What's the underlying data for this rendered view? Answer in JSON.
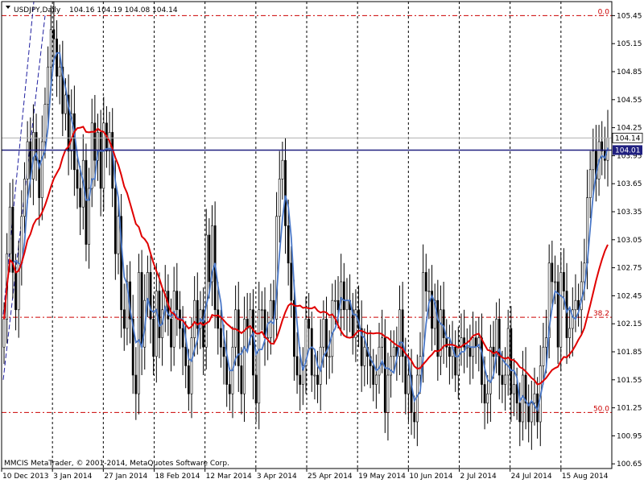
{
  "header": {
    "symbol": "USDJPY,Daily",
    "ohlc": "104.16 104.19 104.08 104.14"
  },
  "footer": {
    "copyright": "MMCIS MetaTrader, © 2001-2014, MetaQuotes Software Corp."
  },
  "colors": {
    "background": "#ffffff",
    "frame": "#000000",
    "grid": "#000000",
    "ma_fast": "#4a78c8",
    "ma_slow": "#e00000",
    "fib": "#cc0000",
    "price_line": "#202080",
    "candle_body": "#000000"
  },
  "chart_data": {
    "type": "candlestick",
    "symbol": "USDJPY",
    "timeframe": "Daily",
    "ylim": [
      100.6,
      105.6
    ],
    "grid": true,
    "y_ticks": [
      "105.45",
      "105.15",
      "104.85",
      "104.55",
      "104.25",
      "103.95",
      "103.65",
      "103.35",
      "103.05",
      "102.75",
      "102.45",
      "102.15",
      "101.85",
      "101.55",
      "101.25",
      "100.95",
      "100.65"
    ],
    "x_ticks": [
      "10 Dec 2013",
      "3 Jan 2014",
      "27 Jan 2014",
      "18 Feb 2014",
      "12 Mar 2014",
      "3 Apr 2014",
      "25 Apr 2014",
      "19 May 2014",
      "10 Jun 2014",
      "2 Jul 2014",
      "24 Jul 2014",
      "15 Aug 2014"
    ],
    "current_price_label": "104.14",
    "hline_price_label": "104.01",
    "fibonacci_levels": [
      {
        "label": "0.0",
        "price": 105.45
      },
      {
        "label": "38.2",
        "price": 102.22
      },
      {
        "label": "50.0",
        "price": 101.2
      }
    ],
    "close": [
      102.2,
      102.9,
      103.4,
      102.7,
      102.3,
      102.8,
      103.3,
      103.7,
      104.1,
      103.7,
      104.2,
      103.9,
      103.5,
      104.1,
      104.5,
      104.9,
      105.3,
      105.2,
      104.8,
      104.9,
      104.4,
      104.6,
      104.0,
      104.4,
      103.8,
      103.6,
      103.4,
      103.9,
      103.0,
      103.6,
      104.3,
      103.9,
      104.2,
      103.6,
      104.3,
      104.0,
      104.2,
      103.6,
      102.9,
      103.3,
      102.3,
      102.1,
      102.6,
      102.2,
      101.6,
      101.4,
      102.7,
      101.9,
      102.4,
      102.7,
      102.2,
      101.8,
      102.5,
      102.0,
      102.3,
      102.5,
      102.2,
      101.9,
      102.5,
      102.3,
      102.1,
      101.9,
      101.7,
      101.4,
      102.0,
      102.4,
      102.1,
      102.3,
      101.9,
      103.1,
      102.6,
      103.2,
      102.3,
      102.1,
      101.9,
      101.8,
      101.5,
      101.4,
      101.9,
      102.3,
      101.7,
      101.4,
      102.2,
      102.1,
      102.3,
      101.6,
      101.3,
      102.3,
      102.3,
      102.0,
      102.0,
      102.4,
      102.2,
      103.3,
      103.7,
      103.9,
      103.2,
      102.8,
      102.4,
      101.8,
      101.6,
      101.5,
      101.7,
      102.2,
      102.1,
      101.6,
      101.6,
      101.5,
      101.9,
      102.2,
      101.8,
      101.8,
      102.4,
      102.4,
      102.3,
      102.6,
      102.3,
      102.4,
      102.3,
      102.0,
      102.3,
      102.1,
      101.7,
      101.9,
      101.8,
      101.7,
      101.5,
      101.6,
      101.9,
      102.0,
      101.2,
      101.6,
      101.8,
      101.9,
      101.8,
      102.3,
      101.8,
      101.4,
      101.6,
      101.2,
      101.1,
      101.6,
      101.8,
      102.7,
      102.5,
      102.5,
      102.1,
      102.4,
      101.8,
      102.3,
      102.0,
      101.9,
      101.8,
      101.9,
      101.6,
      101.9,
      102.0,
      101.9,
      101.9,
      101.8,
      102.0,
      101.9,
      102.0,
      101.5,
      101.3,
      101.4,
      101.9,
      101.8,
      102.2,
      101.6,
      101.5,
      101.6,
      102.1,
      101.4,
      101.5,
      101.3,
      101.1,
      101.6,
      101.3,
      101.1,
      101.3,
      101.4,
      101.1,
      101.7,
      101.9,
      102.0,
      102.8,
      102.6,
      102.6,
      101.9,
      102.7,
      102.5,
      102.0,
      102.1,
      102.3,
      102.4,
      102.3,
      102.6,
      102.8,
      103.5,
      103.8,
      104.0,
      103.7,
      104.1,
      104.0,
      103.9,
      104.14
    ]
  }
}
